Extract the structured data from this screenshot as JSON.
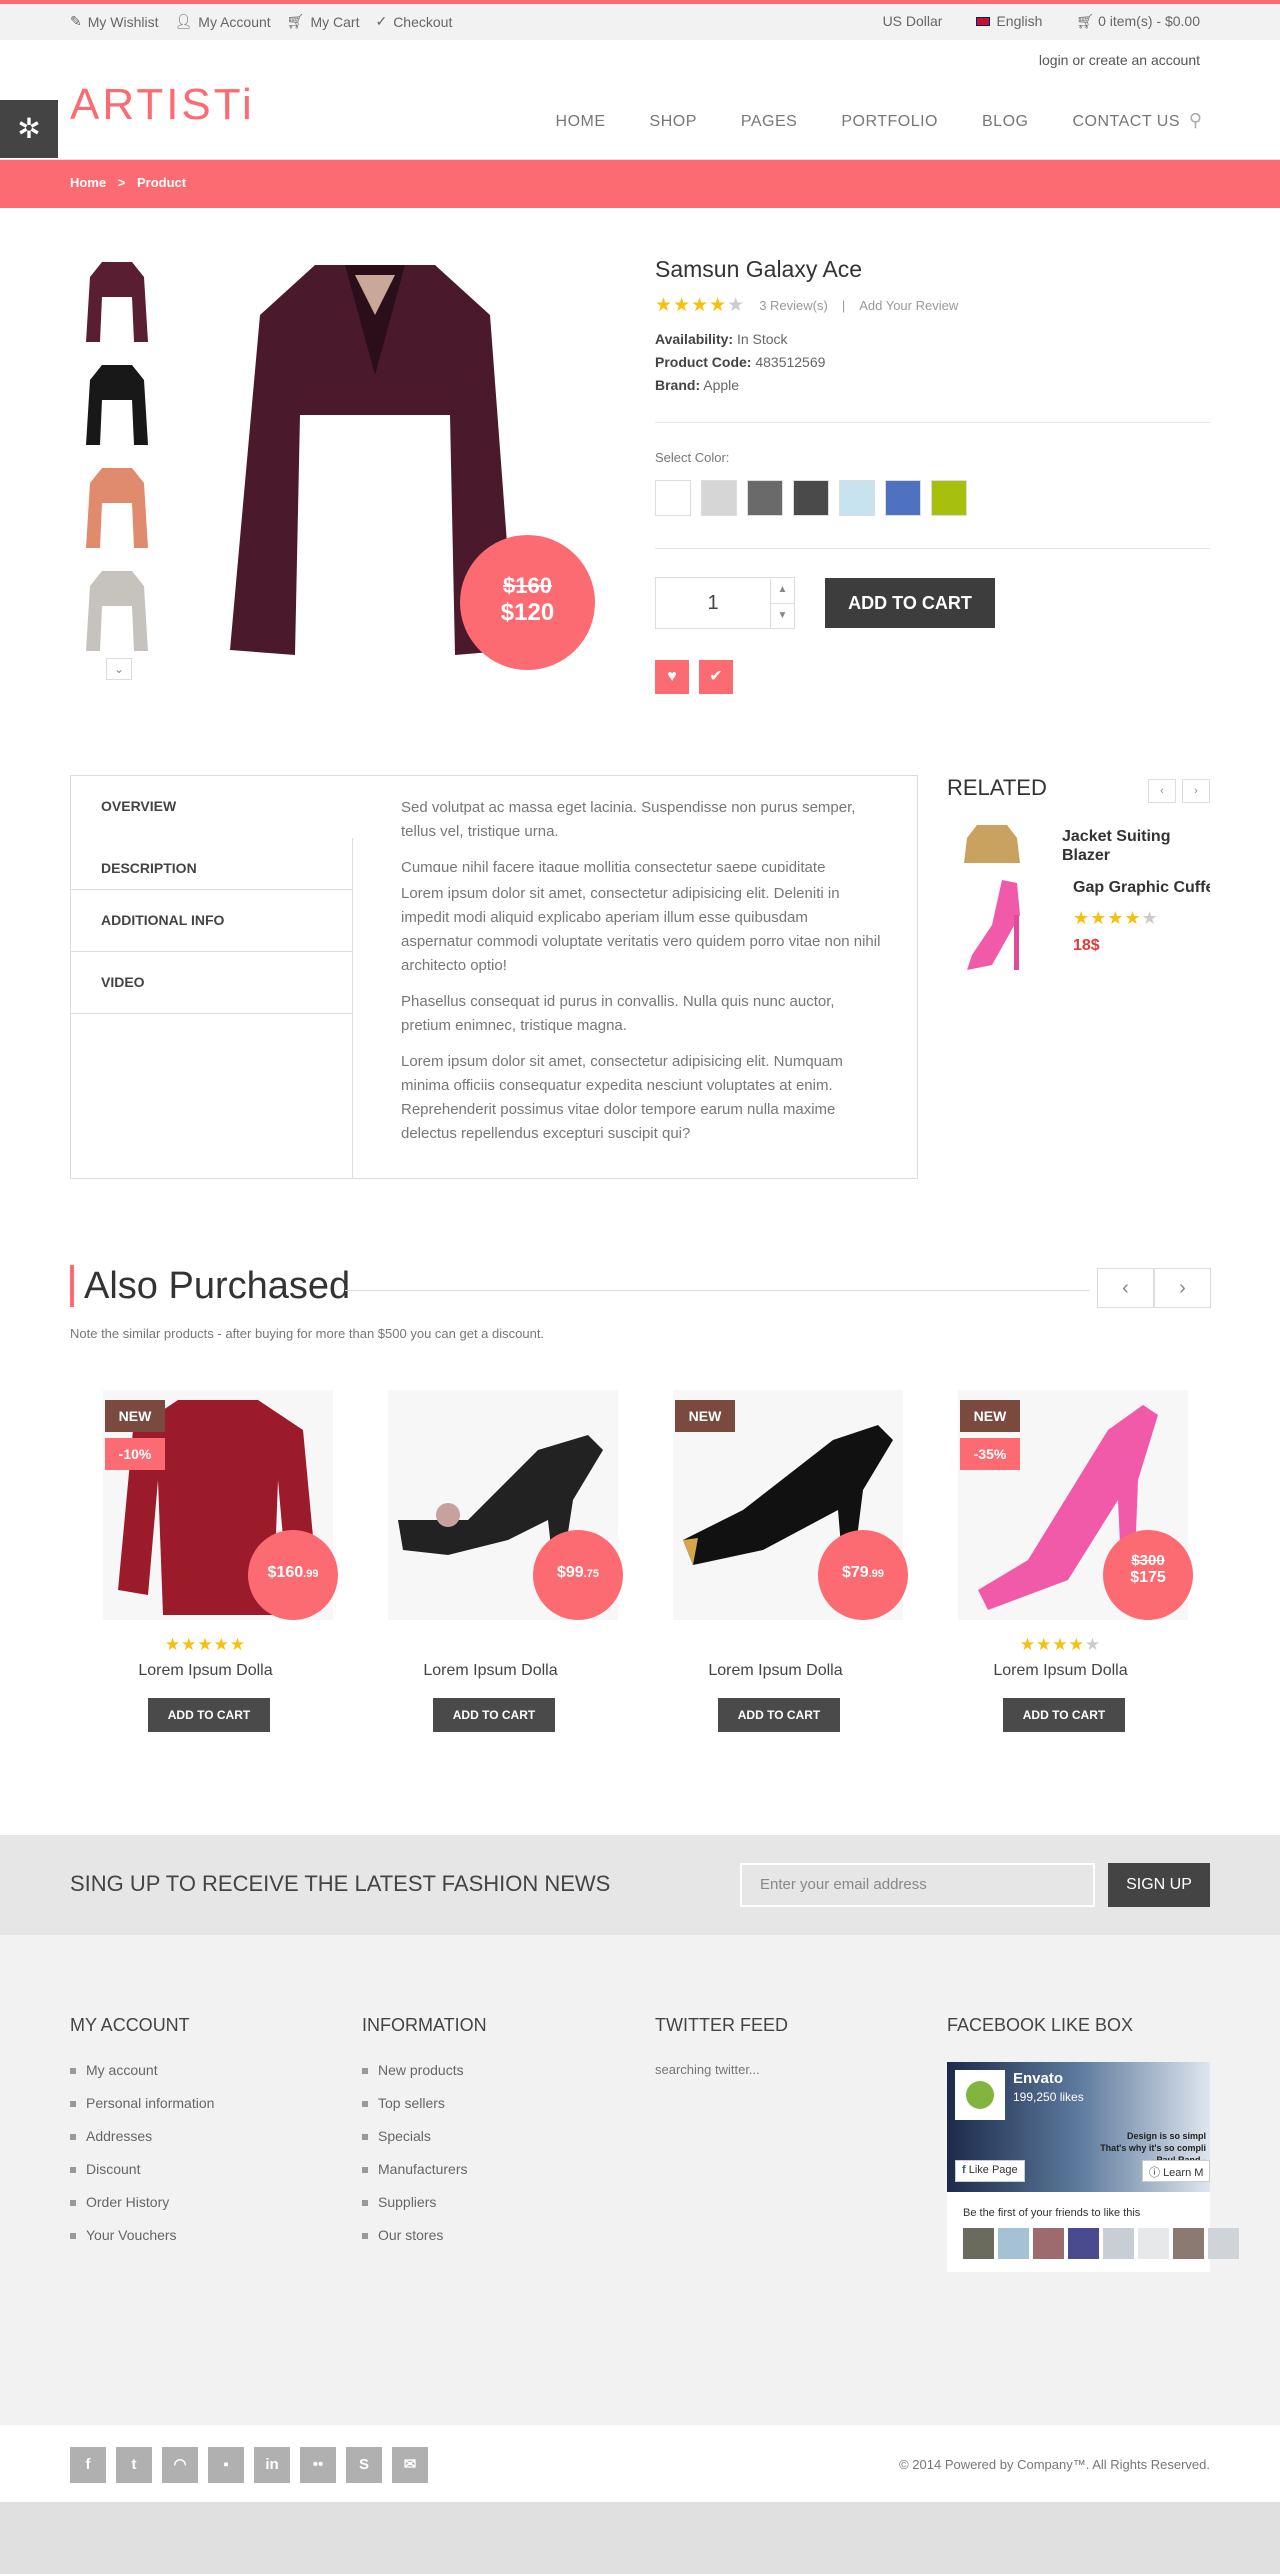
{
  "topbar": {
    "wishlist": "My Wishlist",
    "account": "My Account",
    "cart": "My Cart",
    "checkout": "Checkout",
    "currency": "US Dollar",
    "language": "English",
    "cart_summary": "0 item(s) - $0.00"
  },
  "header": {
    "login": "login or create an account",
    "logo": "ARTISTi",
    "nav": [
      "HOME",
      "SHOP",
      "PAGES",
      "PORTFOLIO",
      "BLOG",
      "CONTACT US"
    ]
  },
  "breadcrumb": [
    "Home",
    ">",
    "Product"
  ],
  "product": {
    "title": "Samsun Galaxy Ace",
    "rating": 3.5,
    "reviews": "3 Review(s)",
    "sep": "|",
    "add_review": "Add Your Review",
    "availability_label": "Availability:",
    "availability": "In Stock",
    "code_label": "Product Code:",
    "code": "483512569",
    "brand_label": "Brand:",
    "brand": "Apple",
    "select_color": "Select Color:",
    "colors": [
      "#ffffff",
      "#d6d6d6",
      "#6a6a6a",
      "#4a4a4a",
      "#c6e3ef",
      "#4f72c0",
      "#a6c00d"
    ],
    "old_price": "$160",
    "price": "$120",
    "qty": "1",
    "add_to_cart": "ADD TO CART",
    "thumb_colors": [
      "#5a1e33",
      "#181818",
      "#e08a6e",
      "#c6c2bd"
    ],
    "main_color": "#4a1a2c"
  },
  "tabs": {
    "items": [
      "OVERVIEW",
      "DESCRIPTION",
      "ADDITIONAL INFO",
      "VIDEO"
    ],
    "paragraphs": [
      "Sed volutpat ac massa eget lacinia. Suspendisse non purus semper, tellus vel, tristique urna.",
      "Cumque nihil facere itaque mollitia consectetur saepe cupiditate",
      "Lorem ipsum dolor sit amet, consectetur adipisicing elit. Deleniti in impedit modi aliquid explicabo aperiam illum esse quibusdam aspernatur commodi voluptate veritatis vero quidem porro vitae non nihil architecto optio!",
      "Phasellus consequat id purus in convallis. Nulla quis nunc auctor, pretium enimnec, tristique magna.",
      "Lorem ipsum dolor sit amet, consectetur adipisicing elit. Numquam minima officiis consequatur expedita nesciunt voluptates at enim. Reprehenderit possimus vitae dolor tempore earum nulla maxime delectus repellendus excepturi suscipit qui?"
    ]
  },
  "related": {
    "title": "RELATED",
    "items": [
      {
        "name": "Jacket Suiting Blazer"
      },
      {
        "name": "Gap Graphic Cuffe",
        "rating": 4,
        "price": "18$"
      }
    ]
  },
  "also_purchased": {
    "title": "Also Purchased",
    "subtitle": "Note the similar products - after buying for more than $500 you can get a discount.",
    "products": [
      {
        "name": "Lorem Ipsum Dolla",
        "badge_new": "NEW",
        "badge_discount": "-10%",
        "price_main": "$160",
        "price_cents": ".99",
        "old_price": "",
        "rating": 5,
        "btn": "ADD TO CART",
        "color": "#9c1b2a"
      },
      {
        "name": "Lorem Ipsum Dolla",
        "badge_new": "",
        "badge_discount": "",
        "price_main": "$99",
        "price_cents": ".75",
        "old_price": "",
        "rating": 0,
        "btn": "ADD TO CART",
        "color": "#222"
      },
      {
        "name": "Lorem Ipsum Dolla",
        "badge_new": "NEW",
        "badge_discount": "",
        "price_main": "$79",
        "price_cents": ".99",
        "old_price": "",
        "rating": 0,
        "btn": "ADD TO CART",
        "color": "#111"
      },
      {
        "name": "Lorem Ipsum Dolla",
        "badge_new": "NEW",
        "badge_discount": "-35%",
        "price_main": "$175",
        "price_cents": "",
        "old_price": "$300",
        "rating": 3.5,
        "btn": "ADD TO CART",
        "color": "#f05aa8"
      }
    ]
  },
  "newsletter": {
    "text": "SING UP TO RECEIVE THE LATEST FASHION NEWS",
    "placeholder": "Enter your email address",
    "button": "SIGN UP"
  },
  "footer": {
    "account_title": "MY ACCOUNT",
    "account_links": [
      "My account",
      "Personal information",
      "Addresses",
      "Discount",
      "Order History",
      "Your Vouchers"
    ],
    "info_title": "INFORMATION",
    "info_links": [
      "New products",
      "Top sellers",
      "Specials",
      "Manufacturers",
      "Suppliers",
      "Our stores"
    ],
    "twitter_title": "TWITTER FEED",
    "twitter_text": "searching twitter...",
    "fb_title": "FACEBOOK LIKE BOX",
    "fb_name": "Envato",
    "fb_likes": "199,250 likes",
    "fb_like_btn": "Like Page",
    "fb_learn": "Learn M",
    "fb_friends": "Be the first of your friends to like this",
    "fb_banner_line1": "Design is so simpl",
    "fb_banner_line2": "That's why it's so compli",
    "fb_banner_line3": "- Paul Rand -"
  },
  "bottom": {
    "copyright": "© 2014 Powered by Company™. All Rights Reserved.",
    "social": [
      "f",
      "t",
      "rss",
      "dl",
      "in",
      "fl",
      "s",
      "mail"
    ]
  }
}
